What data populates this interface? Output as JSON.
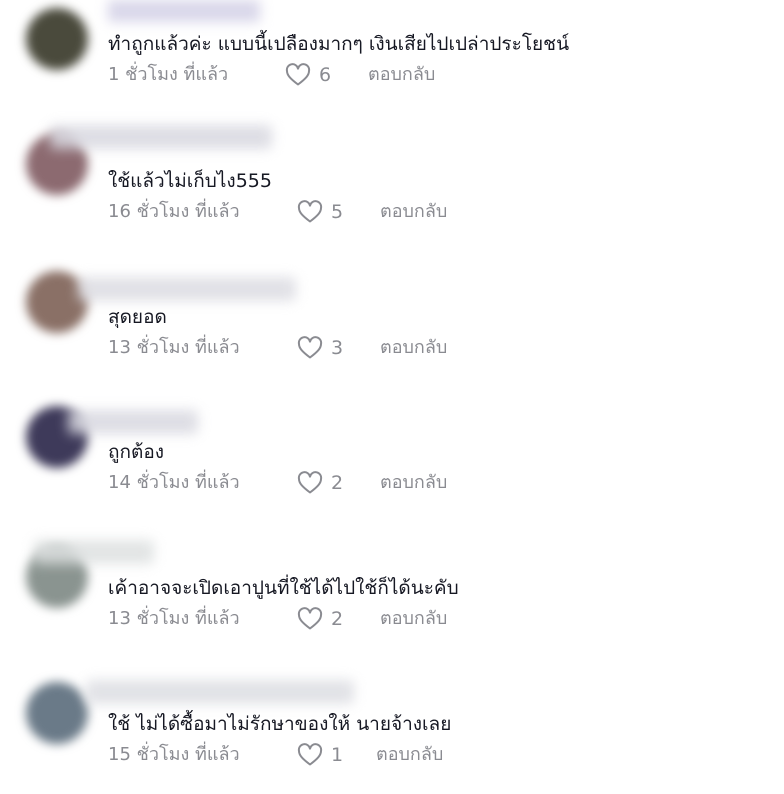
{
  "comments": [
    {
      "text": "ทำถูกแล้วค่ะ แบบนี้เปลืองมากๆ เงินเสียไปเปล่าประโยชน์",
      "time": "1 ชั่วโมง ที่แล้ว",
      "likes": "6",
      "reply": "ตอบกลับ",
      "avatar_color": "#4a4a3c"
    },
    {
      "text": "ใช้แล้วไม่เก็บไง555",
      "time": "16 ชั่วโมง ที่แล้ว",
      "likes": "5",
      "reply": "ตอบกลับ",
      "avatar_color": "#8c6a70"
    },
    {
      "text": "สุดยอด",
      "time": "13 ชั่วโมง ที่แล้ว",
      "likes": "3",
      "reply": "ตอบกลับ",
      "avatar_color": "#8a7066"
    },
    {
      "text": "ถูกต้อง",
      "time": "14 ชั่วโมง ที่แล้ว",
      "likes": "2",
      "reply": "ตอบกลับ",
      "avatar_color": "#3e3a5a"
    },
    {
      "text": "เค้าอาจจะเปิดเอาปูนที่ใช้ได้ไปใช้ก็ได้นะคับ",
      "time": "13 ชั่วโมง ที่แล้ว",
      "likes": "2",
      "reply": "ตอบกลับ",
      "avatar_color": "#8a9490"
    },
    {
      "text": "ใช้ ไม่ได้ซื้อมาไม่รักษาของให้ นายจ้างเลย",
      "time": "15 ชั่วโมง ที่แล้ว",
      "likes": "1",
      "reply": "ตอบกลับ",
      "avatar_color": "#6a7a88"
    }
  ]
}
